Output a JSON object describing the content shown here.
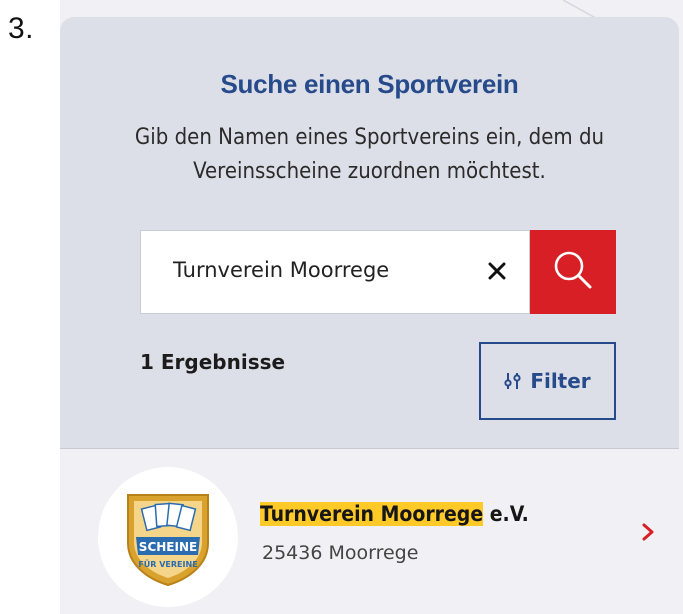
{
  "step": {
    "number": "3."
  },
  "search_card": {
    "title": "Suche einen Sportverein",
    "description": "Gib den Namen eines Sportvereins ein, dem du Vereinsscheine zuordnen möchtest."
  },
  "search": {
    "value": "Turnverein Moorrege",
    "clear_icon": "close-icon",
    "button_icon": "search-icon"
  },
  "results": {
    "count_label": "1 Ergebnisse",
    "filter_label": "Filter",
    "filter_icon": "sliders-icon",
    "items": [
      {
        "name_highlight": "Turnverein Moorrege",
        "name_rest": " e.V.",
        "address": "25436 Moorrege",
        "logo_text": "SCHEINE",
        "logo_subtext": "FÜR VEREINE",
        "chevron_icon": "chevron-right-icon"
      }
    ]
  },
  "colors": {
    "title_blue": "#274a8a",
    "search_red": "#d81f26",
    "highlight_yellow": "#ffc928",
    "card_background": "#dcdfe8",
    "logo_gold": "#d9a22f",
    "logo_blue": "#2b6cb0"
  }
}
